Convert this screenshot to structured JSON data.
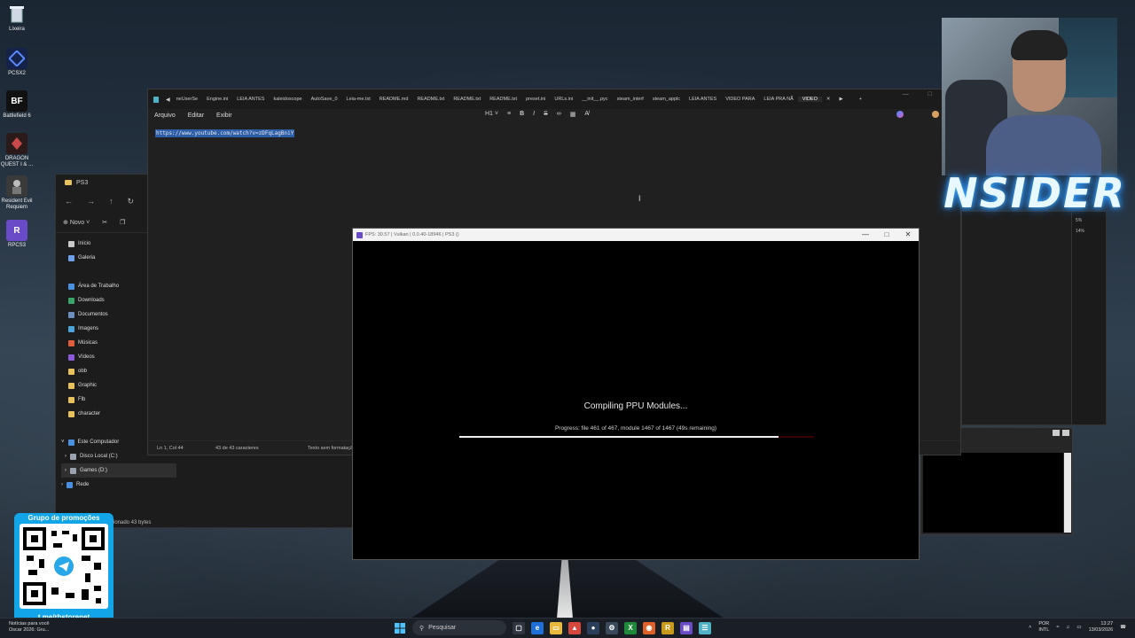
{
  "desktop_icons": [
    {
      "label": "Lixeira",
      "icon": "recycle-bin-icon"
    },
    {
      "label": "PCSX2",
      "icon": "pcsx2-icon"
    },
    {
      "label": "Battlefield 6",
      "icon": "battlefield-icon",
      "glyph": "BF"
    },
    {
      "label": "DRAGON QUEST I & ...",
      "icon": "dragon-quest-icon"
    },
    {
      "label": "Resident Evil Requiem",
      "icon": "resident-evil-icon"
    },
    {
      "label": "RPCS3",
      "icon": "rpcs3-icon",
      "glyph": "R"
    }
  ],
  "explorer": {
    "title": "PS3",
    "new_label": "Novo",
    "sidebar": [
      {
        "label": "Início",
        "color": "#c9c9c9"
      },
      {
        "label": "Galeria",
        "color": "#6ca0e8"
      },
      {
        "label": "Área de Trabalho",
        "color": "#4a90e2"
      },
      {
        "label": "Downloads",
        "color": "#3aa56b"
      },
      {
        "label": "Documentos",
        "color": "#6d8fbf"
      },
      {
        "label": "Imagens",
        "color": "#4ba3d8"
      },
      {
        "label": "Músicas",
        "color": "#e05c3a"
      },
      {
        "label": "Vídeos",
        "color": "#8a5ad8"
      },
      {
        "label": "obb",
        "color": "#e8c15a"
      },
      {
        "label": "Graphic",
        "color": "#e8c15a"
      },
      {
        "label": "Flb",
        "color": "#e8c15a"
      },
      {
        "label": "character",
        "color": "#e8c15a"
      }
    ],
    "tree": [
      {
        "label": "Este Computador",
        "color": "#4a90e2"
      },
      {
        "label": "Disco Local (C:)",
        "color": "#9aa4ae"
      },
      {
        "label": "Games (D:)",
        "color": "#9aa4ae"
      },
      {
        "label": "Rede",
        "color": "#4a90e2"
      }
    ],
    "status": "cionado 43 bytes"
  },
  "editor": {
    "tabs": [
      "neUserSe",
      "Engine.ini",
      "LEIA ANTES",
      "kaleidoscope",
      "AutoSave_0",
      "Leia-me.txt",
      "README.md",
      "README.txt",
      "README.txt",
      "README.txt",
      "preset.ini",
      "URLs.ini",
      "__init__.pyc",
      "steam_interf",
      "steam_applc",
      "LEIA ANTES",
      "VIDEO PARA",
      "LEIA PRA NÃ",
      "VIDEO"
    ],
    "active_tab_index": 18,
    "menu": [
      "Arquivo",
      "Editar",
      "Exibir"
    ],
    "heading_label": "H1",
    "content": "https://www.youtube.com/watch?v=zDFqLagBniY",
    "status": {
      "position": "Ln 1, Col 44",
      "chars": "43 de 43 caracteres",
      "format": "Texto sem formatação"
    }
  },
  "game_window": {
    "title": "FPS: 30.57 | Vulkan | 0.0.40-18946 | PS3 ()",
    "heading": "Compiling PPU Modules...",
    "progress_text": "Progress: file 461 of 467, module 1467 of 1467 (49s remaining)",
    "progress_fraction": 0.9
  },
  "right_window": {
    "values": [
      "5%",
      "14%"
    ]
  },
  "overlay": {
    "logo_text": "NSIDER"
  },
  "promo": {
    "title": "Grupo de promoções",
    "link": "t.me/rbstorenet"
  },
  "taskbar": {
    "news_title": "Notícias para você",
    "news_sub": "Oscar 2026: Gru...",
    "search_placeholder": "Pesquisar",
    "language": "POR",
    "layout": "INTL",
    "time": "13:27",
    "date": "13/03/2026"
  }
}
